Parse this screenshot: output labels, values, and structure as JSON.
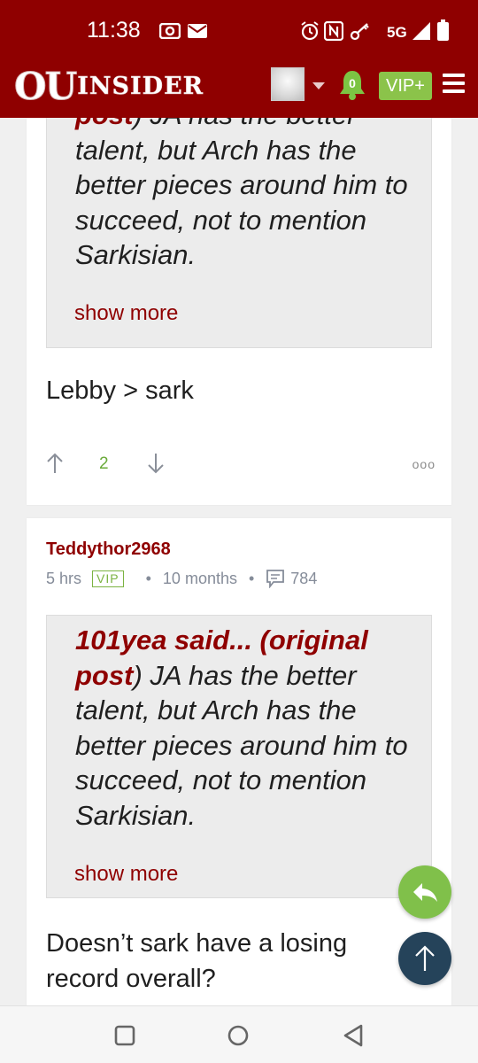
{
  "status_bar": {
    "time": "11:38",
    "network": "5G",
    "icons": [
      "camera-icon",
      "mail-icon",
      "alarm-icon",
      "nfc-icon",
      "key-icon",
      "signal-icon",
      "battery-icon"
    ]
  },
  "header": {
    "logo_ou": "OU",
    "logo_insider": "INSIDER",
    "notifications_count": "0",
    "vip_label": "VIP+",
    "icons": [
      "avatar",
      "chevron-down-icon",
      "bell-icon",
      "hamburger-menu-icon"
    ]
  },
  "posts": [
    {
      "quote": {
        "post_label": "post",
        "text": ") JA has the better talent, but Arch has the better pieces around him to succeed, not to mention Sarkisian.",
        "show_more": "show more"
      },
      "body": "Lebby > sark",
      "votes": "2",
      "more_icon": "ooo"
    },
    {
      "author": "Teddythor2968",
      "time_ago": "5 hrs",
      "badge": "VIP",
      "member_since": "10 months",
      "post_count": "784",
      "quote": {
        "said": "101yea said...",
        "original": " (original",
        "post_label": "post",
        "text": ") JA has the better talent, but Arch has the better pieces around him to succeed, not to mention Sarkisian.",
        "show_more": "show more"
      },
      "body": "Doesn’t sark have a losing record overall?"
    }
  ],
  "colors": {
    "brand": "#8f0000",
    "vip_green": "#8bc34a",
    "reply_fab": "#80c04a",
    "top_fab": "#25435a"
  },
  "fabs": [
    "reply-icon",
    "arrow-up-icon"
  ],
  "nav": [
    "recent-apps-icon",
    "home-icon",
    "back-icon"
  ]
}
